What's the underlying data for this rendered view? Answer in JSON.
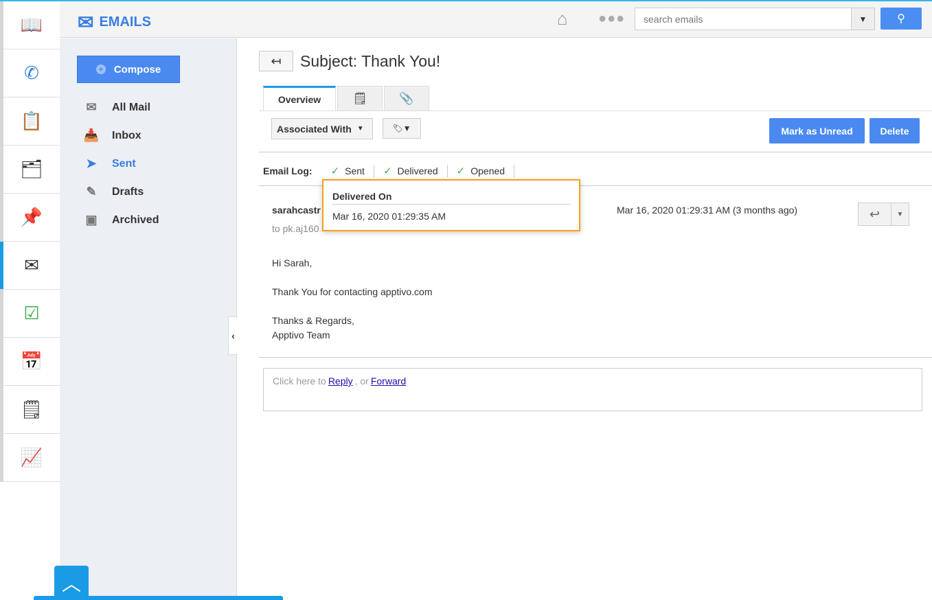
{
  "app": {
    "title": "EMAILS"
  },
  "rail": [
    "docs",
    "calls",
    "forms",
    "contacts",
    "pin",
    "emails",
    "tasks",
    "calendar",
    "notes",
    "reports"
  ],
  "search": {
    "placeholder": "search emails"
  },
  "sidebar": {
    "compose": "Compose",
    "items": [
      {
        "label": "All Mail",
        "icon": "envelope"
      },
      {
        "label": "Inbox",
        "icon": "inbox"
      },
      {
        "label": "Sent",
        "icon": "paper-plane"
      },
      {
        "label": "Drafts",
        "icon": "draft"
      },
      {
        "label": "Archived",
        "icon": "archive"
      }
    ]
  },
  "email": {
    "subject": "Subject: Thank You!",
    "tabs": {
      "overview": "Overview"
    },
    "associated_with": "Associated With",
    "mark_unread": "Mark as Unread",
    "delete": "Delete",
    "log_label": "Email Log:",
    "log": [
      "Sent",
      "Delivered",
      "Opened"
    ],
    "from": "sarahcastr",
    "to": "to pk.aj160",
    "date": "Mar 16, 2020 01:29:31 AM (3 months ago)",
    "body": [
      "Hi Sarah,",
      "Thank You for contacting apptivo.com",
      "Thanks & Regards,",
      "Apptivo Team"
    ],
    "reply_prefix": "Click here to",
    "reply": "Reply",
    "or": ", or",
    "forward": "Forward"
  },
  "tooltip": {
    "title": "Delivered On",
    "value": "Mar 16, 2020 01:29:35 AM"
  }
}
